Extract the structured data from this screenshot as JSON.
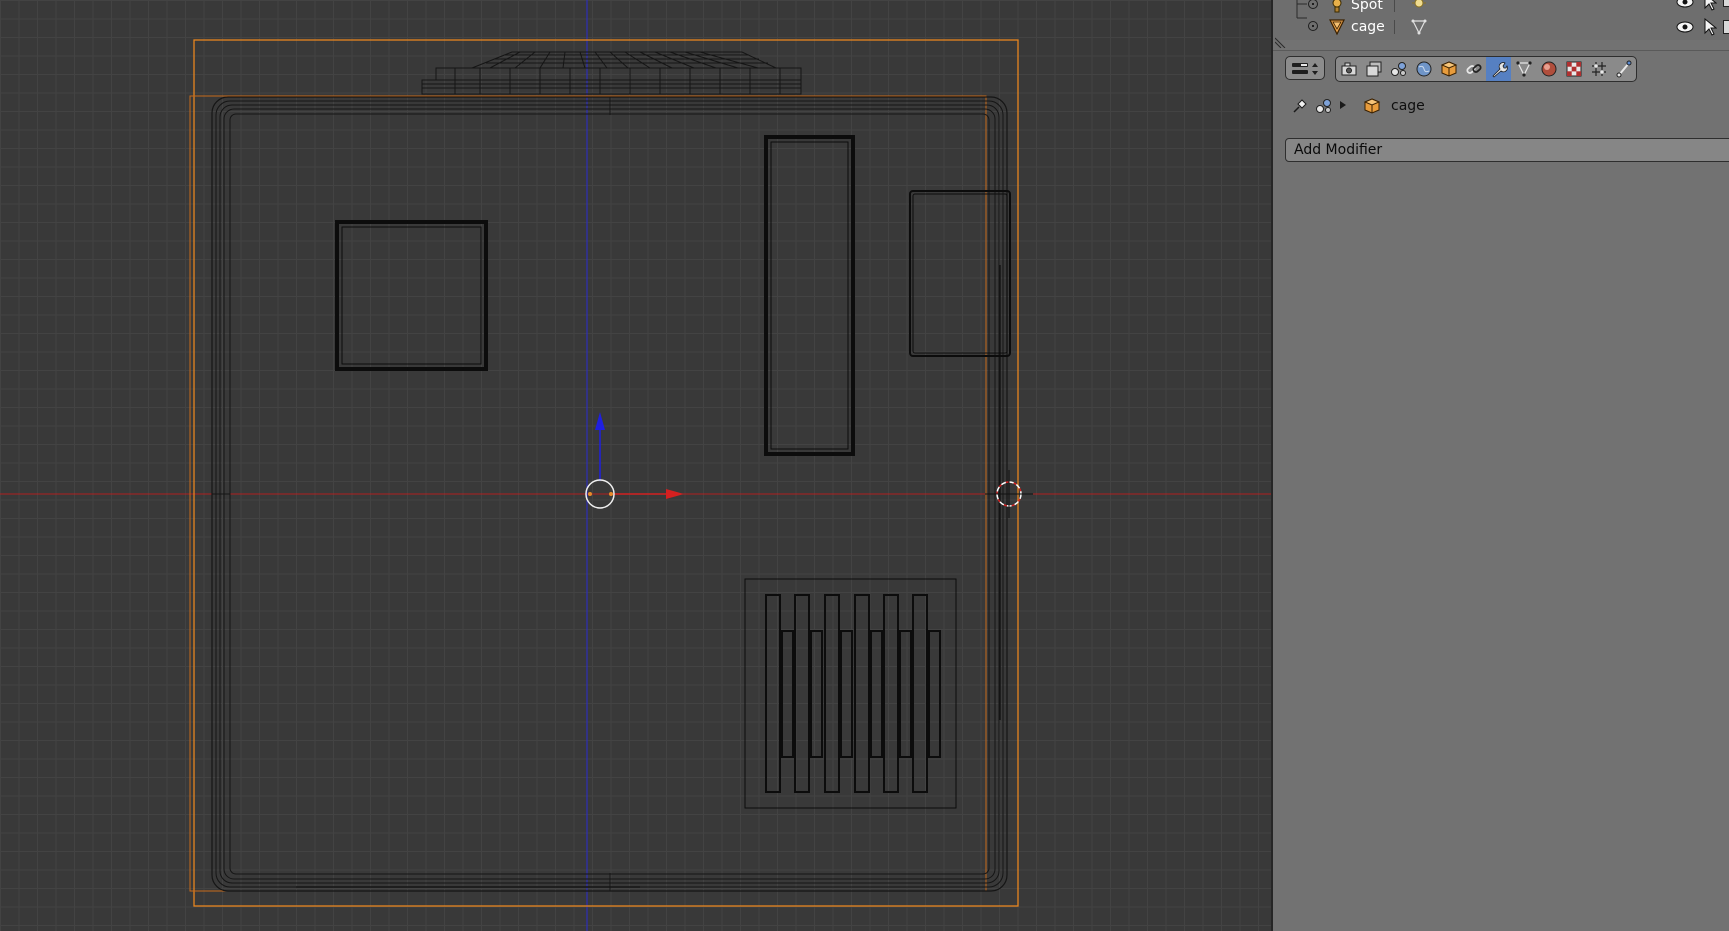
{
  "outliner": {
    "rows": [
      {
        "label": "Spot",
        "icon": "lamp-object-icon",
        "data_icon": "lamp-data-icon"
      },
      {
        "label": "cage",
        "icon": "mesh-object-icon",
        "data_icon": "mesh-data-icon"
      }
    ]
  },
  "properties": {
    "editor_type_icon": "editor-type-icon",
    "context_tabs": [
      {
        "name": "render",
        "icon": "camera-icon"
      },
      {
        "name": "render-layers",
        "icon": "render-layers-icon"
      },
      {
        "name": "scene",
        "icon": "scene-icon"
      },
      {
        "name": "world",
        "icon": "world-icon"
      },
      {
        "name": "object",
        "icon": "cube-icon"
      },
      {
        "name": "constraints",
        "icon": "link-icon"
      },
      {
        "name": "modifiers",
        "icon": "wrench-icon",
        "active": true
      },
      {
        "name": "data",
        "icon": "mesh-data-icon"
      },
      {
        "name": "material",
        "icon": "material-sphere-icon"
      },
      {
        "name": "texture",
        "icon": "checker-texture-icon"
      },
      {
        "name": "particles",
        "icon": "particles-icon"
      },
      {
        "name": "physics",
        "icon": "physics-icon"
      }
    ],
    "breadcrumb": {
      "object_label": "cage"
    },
    "add_modifier_label": "Add Modifier"
  },
  "colors": {
    "viewport_bg": "#393939",
    "grid_line": "#434343",
    "x_axis": "#cc2222",
    "z_axis": "#2a2ad0",
    "selection_outline": "#e8851e",
    "panel_bg": "#727272",
    "active_tab": "#5680c2"
  }
}
